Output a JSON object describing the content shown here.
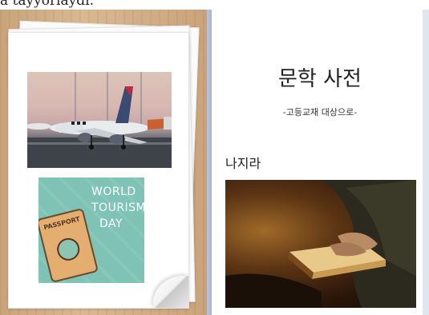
{
  "caption": {
    "partial_text": "a tayyorlaydi."
  },
  "left_page": {
    "images": {
      "airplane": {
        "icon": "airplane-photo"
      },
      "tourism_card": {
        "lines": [
          "WORLD",
          "TOURISM",
          "DAY"
        ],
        "passport_label": "PASSPORT",
        "background_color": "#7ec3b5"
      }
    }
  },
  "right_page": {
    "title": "문학 사전",
    "subtitle": "-고등교재 대상으로-",
    "author": "나지라",
    "image": {
      "icon": "reading-book-photo"
    }
  }
}
